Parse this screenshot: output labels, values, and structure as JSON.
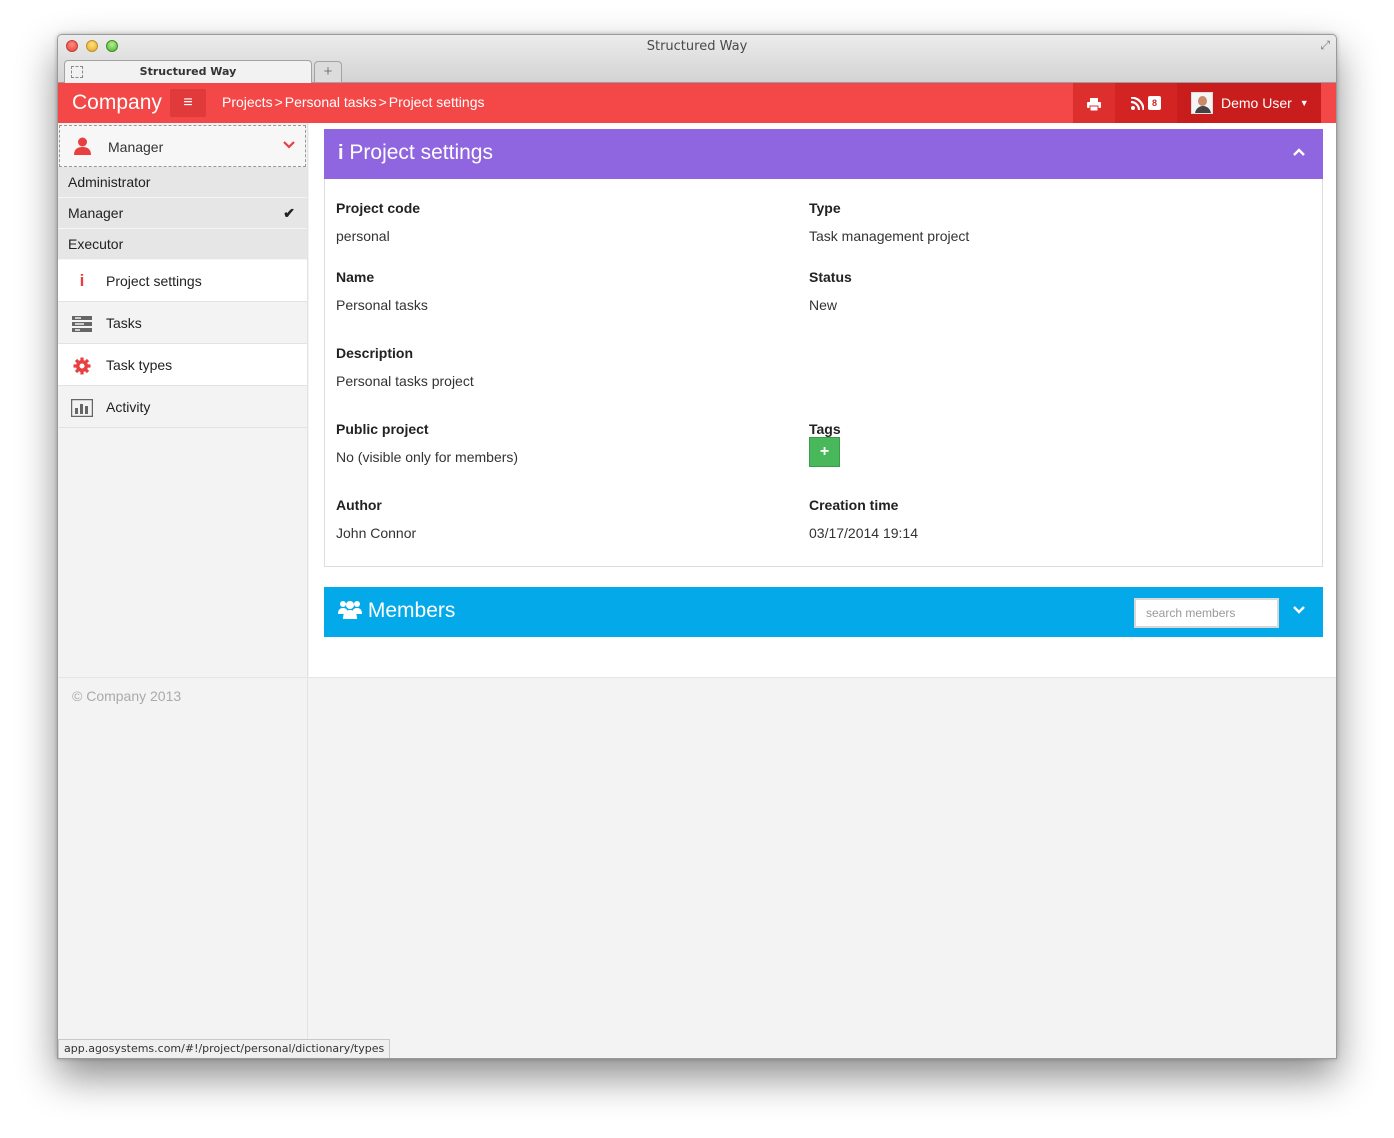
{
  "window": {
    "title": "Structured Way",
    "tab_title": "Structured Way",
    "new_tab": "+"
  },
  "header": {
    "brand": "Company",
    "breadcrumb": [
      "Projects",
      "Personal tasks",
      "Project settings"
    ],
    "breadcrumb_sep": ">",
    "rss_count": "8",
    "user_name": "Demo User",
    "accent": "#f44747"
  },
  "sidebar": {
    "role_selected": "Manager",
    "roles": [
      "Administrator",
      "Manager",
      "Executor"
    ],
    "role_checked": "Manager",
    "nav": [
      {
        "label": "Project settings",
        "icon": "info-icon"
      },
      {
        "label": "Tasks",
        "icon": "tasks-icon"
      },
      {
        "label": "Task types",
        "icon": "gear-icon"
      },
      {
        "label": "Activity",
        "icon": "chart-icon"
      }
    ],
    "copyright": "© Company 2013"
  },
  "project_settings": {
    "title": "Project settings",
    "header_color": "#9066e0",
    "fields": {
      "project_code": {
        "label": "Project code",
        "value": "personal"
      },
      "type": {
        "label": "Type",
        "value": "Task management project"
      },
      "name": {
        "label": "Name",
        "value": "Personal tasks"
      },
      "status": {
        "label": "Status",
        "value": "New"
      },
      "description": {
        "label": "Description",
        "value": "Personal tasks project"
      },
      "public_project": {
        "label": "Public project",
        "value": "No (visible only for members)"
      },
      "tags": {
        "label": "Tags"
      },
      "author": {
        "label": "Author",
        "value": "John Connor"
      },
      "creation_time": {
        "label": "Creation time",
        "value": "03/17/2014 19:14"
      }
    }
  },
  "members": {
    "title": "Members",
    "header_color": "#04a9ea",
    "search_placeholder": "search members"
  },
  "statusbar": {
    "url": "app.agosystems.com/#!/project/personal/dictionary/types"
  }
}
